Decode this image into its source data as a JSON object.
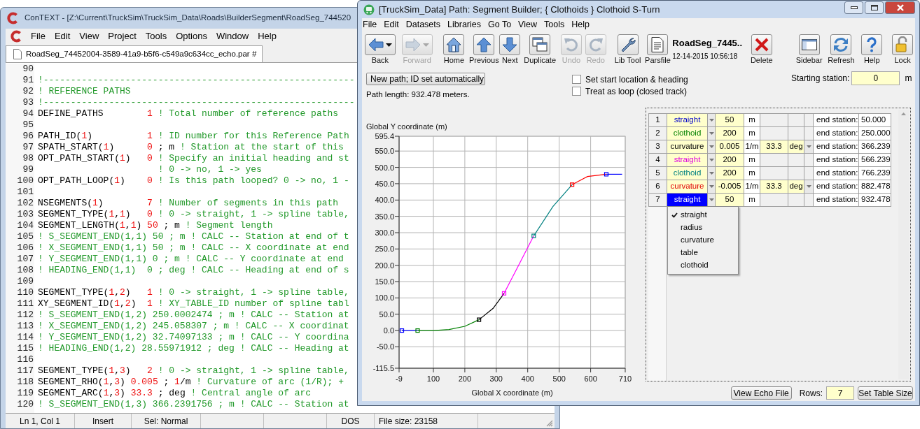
{
  "editor_window": {
    "title": "ConTEXT - [Z:\\Current\\TruckSim\\TruckSim_Data\\Roads\\BuilderSegment\\RoadSeg_744520",
    "menu": [
      "File",
      "Edit",
      "View",
      "Project",
      "Tools",
      "Options",
      "Window",
      "Help"
    ],
    "tab": {
      "label": "RoadSeg_74452004-3589-41a9-b5f6-c549a9c634cc_echo.par #",
      "selected": true
    },
    "lines": [
      {
        "n": "90"
      },
      {
        "n": "91",
        "parts": [
          {
            "kind": "comment",
            "text": "!---------------------------------------------------------"
          }
        ]
      },
      {
        "n": "92",
        "parts": [
          {
            "kind": "comment",
            "text": "! REFERENCE PATHS"
          }
        ]
      },
      {
        "n": "93",
        "parts": [
          {
            "kind": "comment",
            "text": "!---------------------------------------------------------"
          }
        ]
      },
      {
        "n": "94",
        "parts": [
          {
            "kind": "code",
            "text": "DEFINE_PATHS        "
          },
          {
            "kind": "value",
            "text": "1"
          },
          {
            "kind": "comment",
            "text": " ! Total number of reference paths"
          }
        ]
      },
      {
        "n": "95"
      },
      {
        "n": "96",
        "parts": [
          {
            "kind": "code",
            "text": "PATH_ID("
          },
          {
            "kind": "value",
            "text": "1"
          },
          {
            "kind": "code",
            "text": ")          "
          },
          {
            "kind": "value",
            "text": "1"
          },
          {
            "kind": "comment",
            "text": " ! ID number for this Reference Path"
          }
        ]
      },
      {
        "n": "97",
        "parts": [
          {
            "kind": "code",
            "text": "SPATH_START("
          },
          {
            "kind": "value",
            "text": "1"
          },
          {
            "kind": "code",
            "text": ")      "
          },
          {
            "kind": "value",
            "text": "0"
          },
          {
            "kind": "code",
            "text": " ; m "
          },
          {
            "kind": "comment",
            "text": "! Station at the start of this"
          }
        ]
      },
      {
        "n": "98",
        "parts": [
          {
            "kind": "code",
            "text": "OPT_PATH_START("
          },
          {
            "kind": "value",
            "text": "1"
          },
          {
            "kind": "code",
            "text": ")   "
          },
          {
            "kind": "value",
            "text": "0"
          },
          {
            "kind": "comment",
            "text": " ! Specify an initial heading and st"
          }
        ]
      },
      {
        "n": "99",
        "parts": [
          {
            "kind": "comment",
            "text": "                      ! 0 -> no, 1 -> yes"
          }
        ]
      },
      {
        "n": "100",
        "parts": [
          {
            "kind": "code",
            "text": "OPT_PATH_LOOP("
          },
          {
            "kind": "value",
            "text": "1"
          },
          {
            "kind": "code",
            "text": ")    "
          },
          {
            "kind": "value",
            "text": "0"
          },
          {
            "kind": "comment",
            "text": " ! Is this path looped? 0 -> no, 1 -"
          }
        ]
      },
      {
        "n": "101"
      },
      {
        "n": "102",
        "parts": [
          {
            "kind": "code",
            "text": "NSEGMENTS("
          },
          {
            "kind": "value",
            "text": "1"
          },
          {
            "kind": "code",
            "text": ")        "
          },
          {
            "kind": "value",
            "text": "7"
          },
          {
            "kind": "comment",
            "text": " ! Number of segments in this path"
          }
        ]
      },
      {
        "n": "103",
        "parts": [
          {
            "kind": "code",
            "text": "SEGMENT_TYPE("
          },
          {
            "kind": "value",
            "text": "1"
          },
          {
            "kind": "code",
            "text": ","
          },
          {
            "kind": "value",
            "text": "1"
          },
          {
            "kind": "code",
            "text": ")   "
          },
          {
            "kind": "value",
            "text": "0"
          },
          {
            "kind": "comment",
            "text": " ! 0 -> straight, 1 -> spline table,"
          }
        ]
      },
      {
        "n": "104",
        "parts": [
          {
            "kind": "code",
            "text": "SEGMENT_LENGTH("
          },
          {
            "kind": "value",
            "text": "1"
          },
          {
            "kind": "code",
            "text": ","
          },
          {
            "kind": "value",
            "text": "1"
          },
          {
            "kind": "code",
            "text": ") "
          },
          {
            "kind": "value",
            "text": "50"
          },
          {
            "kind": "code",
            "text": " ; m "
          },
          {
            "kind": "comment",
            "text": "! Segment length"
          }
        ]
      },
      {
        "n": "105",
        "parts": [
          {
            "kind": "comment",
            "text": "! S_SEGMENT_END(1,1) 50 ; m ! CALC -- Station at end of t"
          }
        ]
      },
      {
        "n": "106",
        "parts": [
          {
            "kind": "comment",
            "text": "! X_SEGMENT_END(1,1) 50 ; m ! CALC -- X coordinate at end"
          }
        ]
      },
      {
        "n": "107",
        "parts": [
          {
            "kind": "comment",
            "text": "! Y_SEGMENT_END(1,1) 0 ; m ! CALC -- Y coordinate at end"
          }
        ]
      },
      {
        "n": "108",
        "parts": [
          {
            "kind": "comment",
            "text": "! HEADING_END(1,1)  0 ; deg ! CALC -- Heading at end of s"
          }
        ]
      },
      {
        "n": "109"
      },
      {
        "n": "110",
        "parts": [
          {
            "kind": "code",
            "text": "SEGMENT_TYPE("
          },
          {
            "kind": "value",
            "text": "1"
          },
          {
            "kind": "code",
            "text": ","
          },
          {
            "kind": "value",
            "text": "2"
          },
          {
            "kind": "code",
            "text": ")   "
          },
          {
            "kind": "value",
            "text": "1"
          },
          {
            "kind": "comment",
            "text": " ! 0 -> straight, 1 -> spline table,"
          }
        ]
      },
      {
        "n": "111",
        "parts": [
          {
            "kind": "code",
            "text": "XY_SEGMENT_ID("
          },
          {
            "kind": "value",
            "text": "1"
          },
          {
            "kind": "code",
            "text": ","
          },
          {
            "kind": "value",
            "text": "2"
          },
          {
            "kind": "code",
            "text": ")  "
          },
          {
            "kind": "value",
            "text": "1"
          },
          {
            "kind": "comment",
            "text": " ! XY_TABLE_ID number of spline tabl"
          }
        ]
      },
      {
        "n": "112",
        "parts": [
          {
            "kind": "comment",
            "text": "! S_SEGMENT_END(1,2) 250.0002474 ; m ! CALC -- Station at"
          }
        ]
      },
      {
        "n": "113",
        "parts": [
          {
            "kind": "comment",
            "text": "! X_SEGMENT_END(1,2) 245.058307 ; m ! CALC -- X coordinat"
          }
        ]
      },
      {
        "n": "114",
        "parts": [
          {
            "kind": "comment",
            "text": "! Y_SEGMENT_END(1,2) 32.74097133 ; m ! CALC -- Y coordina"
          }
        ]
      },
      {
        "n": "115",
        "parts": [
          {
            "kind": "comment",
            "text": "! HEADING_END(1,2) 28.55971912 ; deg ! CALC -- Heading at"
          }
        ]
      },
      {
        "n": "116"
      },
      {
        "n": "117",
        "parts": [
          {
            "kind": "code",
            "text": "SEGMENT_TYPE("
          },
          {
            "kind": "value",
            "text": "1"
          },
          {
            "kind": "code",
            "text": ","
          },
          {
            "kind": "value",
            "text": "3"
          },
          {
            "kind": "code",
            "text": ")   "
          },
          {
            "kind": "value",
            "text": "2"
          },
          {
            "kind": "comment",
            "text": " ! 0 -> straight, 1 -> spline table,"
          }
        ]
      },
      {
        "n": "118",
        "parts": [
          {
            "kind": "code",
            "text": "SEGMENT_RHO("
          },
          {
            "kind": "value",
            "text": "1"
          },
          {
            "kind": "code",
            "text": ","
          },
          {
            "kind": "value",
            "text": "3"
          },
          {
            "kind": "code",
            "text": ") "
          },
          {
            "kind": "value",
            "text": "0.005"
          },
          {
            "kind": "code",
            "text": " ; "
          },
          {
            "kind": "value",
            "text": "1"
          },
          {
            "kind": "code",
            "text": "/m "
          },
          {
            "kind": "comment",
            "text": "! Curvature of arc (1/R); +"
          }
        ]
      },
      {
        "n": "119",
        "parts": [
          {
            "kind": "code",
            "text": "SEGMENT_ARC("
          },
          {
            "kind": "value",
            "text": "1"
          },
          {
            "kind": "code",
            "text": ","
          },
          {
            "kind": "value",
            "text": "3"
          },
          {
            "kind": "code",
            "text": ") "
          },
          {
            "kind": "value",
            "text": "33.3"
          },
          {
            "kind": "code",
            "text": " ; deg "
          },
          {
            "kind": "comment",
            "text": "! Central angle of arc"
          }
        ]
      },
      {
        "n": "120",
        "parts": [
          {
            "kind": "comment",
            "text": "! S_SEGMENT_END(1,3) 366.2391756 ; m ! CALC -- Station at"
          }
        ]
      }
    ],
    "status_bar": [
      "Ln 1, Col 1",
      "Insert",
      "Sel: Normal",
      "DOS",
      "File size: 23158"
    ]
  },
  "builder_window": {
    "title": "[TruckSim_Data] Path: Segment Builder; { Clothoids } Clothoid S-Turn",
    "menu": [
      "File",
      "Edit",
      "Datasets",
      "Libraries",
      "Go To",
      "View",
      "Tools",
      "Help"
    ],
    "toolbar": [
      {
        "kind": "back",
        "label": "Back",
        "disabled": false,
        "dropdown": true
      },
      {
        "kind": "forward",
        "label": "Forward",
        "disabled": true,
        "dropdown": true
      },
      {
        "kind": "home",
        "label": "Home",
        "disabled": false,
        "dropdown": false
      },
      {
        "kind": "previous",
        "label": "Previous",
        "disabled": false,
        "dropdown": false
      },
      {
        "kind": "next",
        "label": "Next",
        "disabled": false,
        "dropdown": false
      },
      {
        "kind": "duplicate",
        "label": "Duplicate",
        "disabled": false,
        "dropdown": false
      },
      {
        "kind": "undo",
        "label": "Undo",
        "disabled": true,
        "dropdown": false
      },
      {
        "kind": "redo",
        "label": "Redo",
        "disabled": true,
        "dropdown": false
      },
      {
        "kind": "libtool",
        "label": "Lib Tool",
        "disabled": false,
        "dropdown": false
      },
      {
        "kind": "parsfile",
        "label": "Parsfile",
        "disabled": false,
        "dropdown": false
      },
      {
        "kind": "info",
        "name": "RoadSeg_7445..",
        "date": "12-14-2015 10:56:18"
      },
      {
        "kind": "delete",
        "label": "Delete",
        "disabled": false,
        "dropdown": false
      },
      {
        "kind": "sidebar",
        "label": "Sidebar",
        "disabled": false,
        "dropdown": false
      },
      {
        "kind": "refresh",
        "label": "Refresh",
        "disabled": false,
        "dropdown": false
      },
      {
        "kind": "help",
        "label": "Help",
        "disabled": false,
        "dropdown": false
      },
      {
        "kind": "lock",
        "label": "Lock",
        "disabled": false,
        "dropdown": false
      }
    ],
    "path_mode": "New path; ID set automatically",
    "path_length": "Path length: 932.478 meters.",
    "options": [
      {
        "label": "Set start location & heading",
        "checked": false
      },
      {
        "label": "Treat as loop (closed track)",
        "checked": false
      }
    ],
    "starting_station": {
      "label": "Starting station:",
      "value": "0",
      "unit": "m"
    },
    "chart": {
      "chart_data": {
        "type": "line",
        "xlabel": "Global X coordinate (m)",
        "ylabel": "Global Y coordinate (m)",
        "x": [
          0,
          50,
          100,
          150,
          200,
          245,
          290,
          325,
          372,
          419,
          480,
          541,
          590,
          650,
          700
        ],
        "series": [
          {
            "color": "#0000ff",
            "values": [
              0,
              0,
              null,
              null,
              null,
              null,
              null,
              null,
              null,
              null,
              null,
              null,
              null,
              null,
              null
            ]
          },
          {
            "color": "#008000",
            "values": [
              null,
              0,
              0,
              3,
              13,
              33,
              null,
              null,
              null,
              null,
              null,
              null,
              null,
              null,
              null
            ]
          },
          {
            "color": "#000000",
            "values": [
              null,
              null,
              null,
              null,
              null,
              33,
              68,
              114,
              null,
              null,
              null,
              null,
              null,
              null,
              null
            ]
          },
          {
            "color": "#ff00ff",
            "values": [
              null,
              null,
              null,
              null,
              null,
              null,
              null,
              114,
              202,
              290,
              null,
              null,
              null,
              null,
              null
            ]
          },
          {
            "color": "#008080",
            "values": [
              null,
              null,
              null,
              null,
              null,
              null,
              null,
              null,
              null,
              290,
              380,
              447,
              null,
              null,
              null
            ]
          },
          {
            "color": "#ff0000",
            "values": [
              null,
              null,
              null,
              null,
              null,
              null,
              null,
              null,
              null,
              null,
              null,
              447,
              472,
              479,
              null
            ]
          },
          {
            "color": "#0000ff",
            "values": [
              null,
              null,
              null,
              null,
              null,
              null,
              null,
              null,
              null,
              null,
              null,
              null,
              null,
              479,
              479
            ]
          }
        ],
        "grid": true,
        "xlim": [
          -9,
          710
        ],
        "ylim": [
          -115.5,
          595.4
        ],
        "xticks": [
          {
            "value": -9,
            "label": "-9"
          },
          100,
          200,
          300,
          400,
          500,
          600,
          {
            "value": 710,
            "label": "710"
          }
        ],
        "yticks": [
          {
            "value": 595.4,
            "label": "595.4"
          },
          {
            "value": 550,
            "label": "550.0"
          },
          {
            "value": 500,
            "label": "500.0"
          },
          {
            "value": 450,
            "label": "450.0"
          },
          {
            "value": 400,
            "label": "400.0"
          },
          {
            "value": 350,
            "label": "350.0"
          },
          {
            "value": 300,
            "label": "300.0"
          },
          {
            "value": 250,
            "label": "250.0"
          },
          {
            "value": 200,
            "label": "200.0"
          },
          {
            "value": 150,
            "label": "150.0"
          },
          {
            "value": 100,
            "label": "100.0"
          },
          {
            "value": 50,
            "label": "50.0"
          },
          {
            "value": 0,
            "label": "0.0"
          },
          {
            "value": -50,
            "label": "-50.0"
          },
          {
            "value": -115.5,
            "label": "-115.5"
          }
        ]
      }
    },
    "table": {
      "rows": [
        {
          "n": "1",
          "type": "straight",
          "color": "#0000cc",
          "selected": false,
          "length": "50",
          "unit": "m",
          "end_label": "end station:",
          "end": "50.000"
        },
        {
          "n": "2",
          "type": "clothoid",
          "color": "#008000",
          "selected": false,
          "length": "200",
          "unit": "m",
          "end_label": "end station:",
          "end": "250.000"
        },
        {
          "n": "3",
          "type": "curvature",
          "color": "#000000",
          "selected": false,
          "length": "0.005",
          "unit": "1/m",
          "arc": "33.3",
          "arc_unit": "deg",
          "end_label": "end station:",
          "end": "366.239"
        },
        {
          "n": "4",
          "type": "straight",
          "color": "#e000e0",
          "selected": false,
          "length": "200",
          "unit": "m",
          "end_label": "end station:",
          "end": "566.239"
        },
        {
          "n": "5",
          "type": "clothoid",
          "color": "#008080",
          "selected": false,
          "length": "200",
          "unit": "m",
          "end_label": "end station:",
          "end": "766.239"
        },
        {
          "n": "6",
          "type": "curvature",
          "color": "#e00000",
          "selected": false,
          "length": "-0.005",
          "unit": "1/m",
          "arc": "33.3",
          "arc_unit": "deg",
          "end_label": "end station:",
          "end": "882.478"
        },
        {
          "n": "7",
          "type": "straight",
          "color": "#0000ff",
          "selected": true,
          "length": "50",
          "unit": "m",
          "end_label": "end station:",
          "end": "932.478"
        }
      ]
    },
    "type_menu": [
      {
        "label": "straight",
        "checked": true
      },
      {
        "label": "radius",
        "checked": false
      },
      {
        "label": "curvature",
        "checked": false
      },
      {
        "label": "table",
        "checked": false
      },
      {
        "label": "clothoid",
        "checked": false
      }
    ],
    "echo_button": "View Echo File",
    "rows_label": "Rows:",
    "rows_value": "7",
    "set_size_button": "Set Table Size"
  }
}
